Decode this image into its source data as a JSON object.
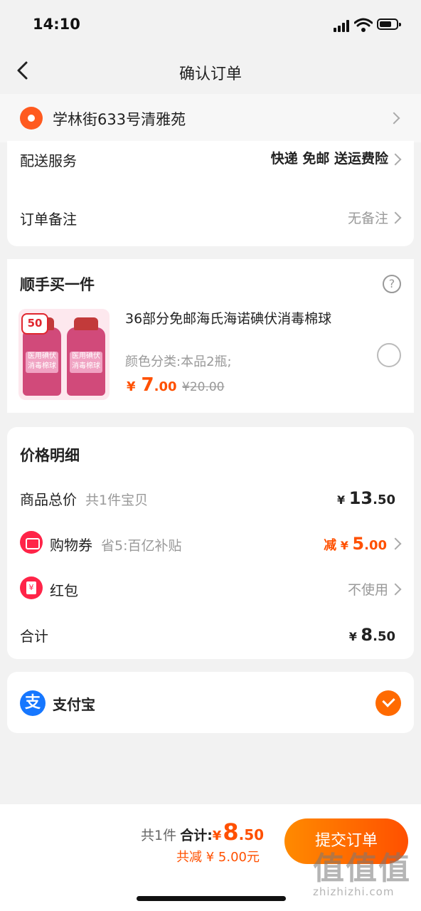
{
  "status_bar": {
    "time": "14:10"
  },
  "nav": {
    "title": "确认订单"
  },
  "address": {
    "text": "学林街633号清雅苑"
  },
  "delivery": {
    "service_label": "配送服务",
    "service_value": "快递 免邮 送运费险",
    "note_label": "订单备注",
    "note_value": "无备注"
  },
  "addon": {
    "title": "顺手买一件",
    "help_icon": "question-circle-icon",
    "product": {
      "badge": "50",
      "bottle_label": "医用碘伏\n消毒棉球",
      "title": "36部分免邮海氏海诺碘伏消毒棉球",
      "spec": "颜色分类:本品2瓶;",
      "price_symbol": "¥",
      "price_int": "7",
      "price_dec": ".00",
      "price_old": "¥20.00"
    }
  },
  "price_detail": {
    "title": "价格明细",
    "goods_label": "商品总价",
    "goods_note": "共1件宝贝",
    "goods_currency": "¥",
    "goods_int": "13",
    "goods_dec": ".50",
    "coupon_label": "购物券",
    "coupon_note": "省5:百亿补贴",
    "coupon_prefix": "减",
    "coupon_currency": "¥",
    "coupon_int": "5",
    "coupon_dec": ".00",
    "redpack_label": "红包",
    "redpack_value": "不使用",
    "total_label": "合计",
    "total_currency": "¥",
    "total_int": "8",
    "total_dec": ".50"
  },
  "payment": {
    "icon_text": "支",
    "label": "支付宝",
    "selected": true
  },
  "bottom_bar": {
    "count": "共1件",
    "total_label": "合计:",
    "currency": "¥",
    "total_int": "8",
    "total_dec": ".50",
    "saved": "共减 ¥ 5.00元",
    "submit": "提交订单"
  },
  "watermark": {
    "big": "值值值",
    "small": "zhizhizhi.com"
  },
  "colors": {
    "accent": "#ff5000",
    "alipay": "#1677ff",
    "coupon": "#ff2448"
  }
}
